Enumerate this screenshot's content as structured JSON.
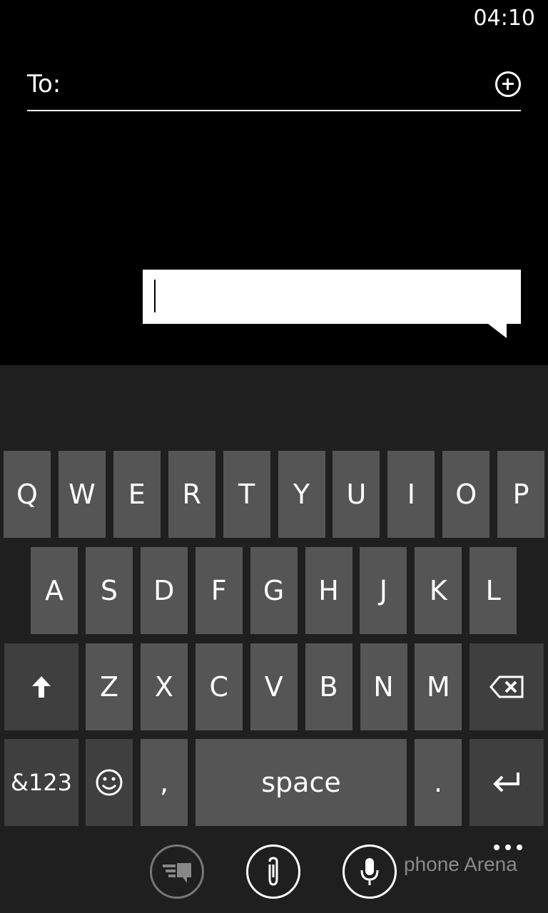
{
  "status": {
    "time": "04:10"
  },
  "recipient": {
    "label": "To:",
    "add_icon": "plus-circle-icon"
  },
  "compose": {
    "value": ""
  },
  "keyboard": {
    "row1": [
      "Q",
      "W",
      "E",
      "R",
      "T",
      "Y",
      "U",
      "I",
      "O",
      "P"
    ],
    "row2": [
      "A",
      "S",
      "D",
      "F",
      "G",
      "H",
      "J",
      "K",
      "L"
    ],
    "row3": [
      "Z",
      "X",
      "C",
      "V",
      "B",
      "N",
      "M"
    ],
    "shift_icon": "arrow-up-icon",
    "backspace_icon": "backspace-icon",
    "symbols_label": "&123",
    "emoji_icon": "smiley-icon",
    "comma_label": ",",
    "space_label": "space",
    "period_label": ".",
    "enter_icon": "enter-icon"
  },
  "appbar": {
    "buttons": [
      "text-message-icon",
      "attach-icon",
      "microphone-icon"
    ],
    "more_icon": "ellipsis-icon"
  },
  "watermark": "phone Arena"
}
